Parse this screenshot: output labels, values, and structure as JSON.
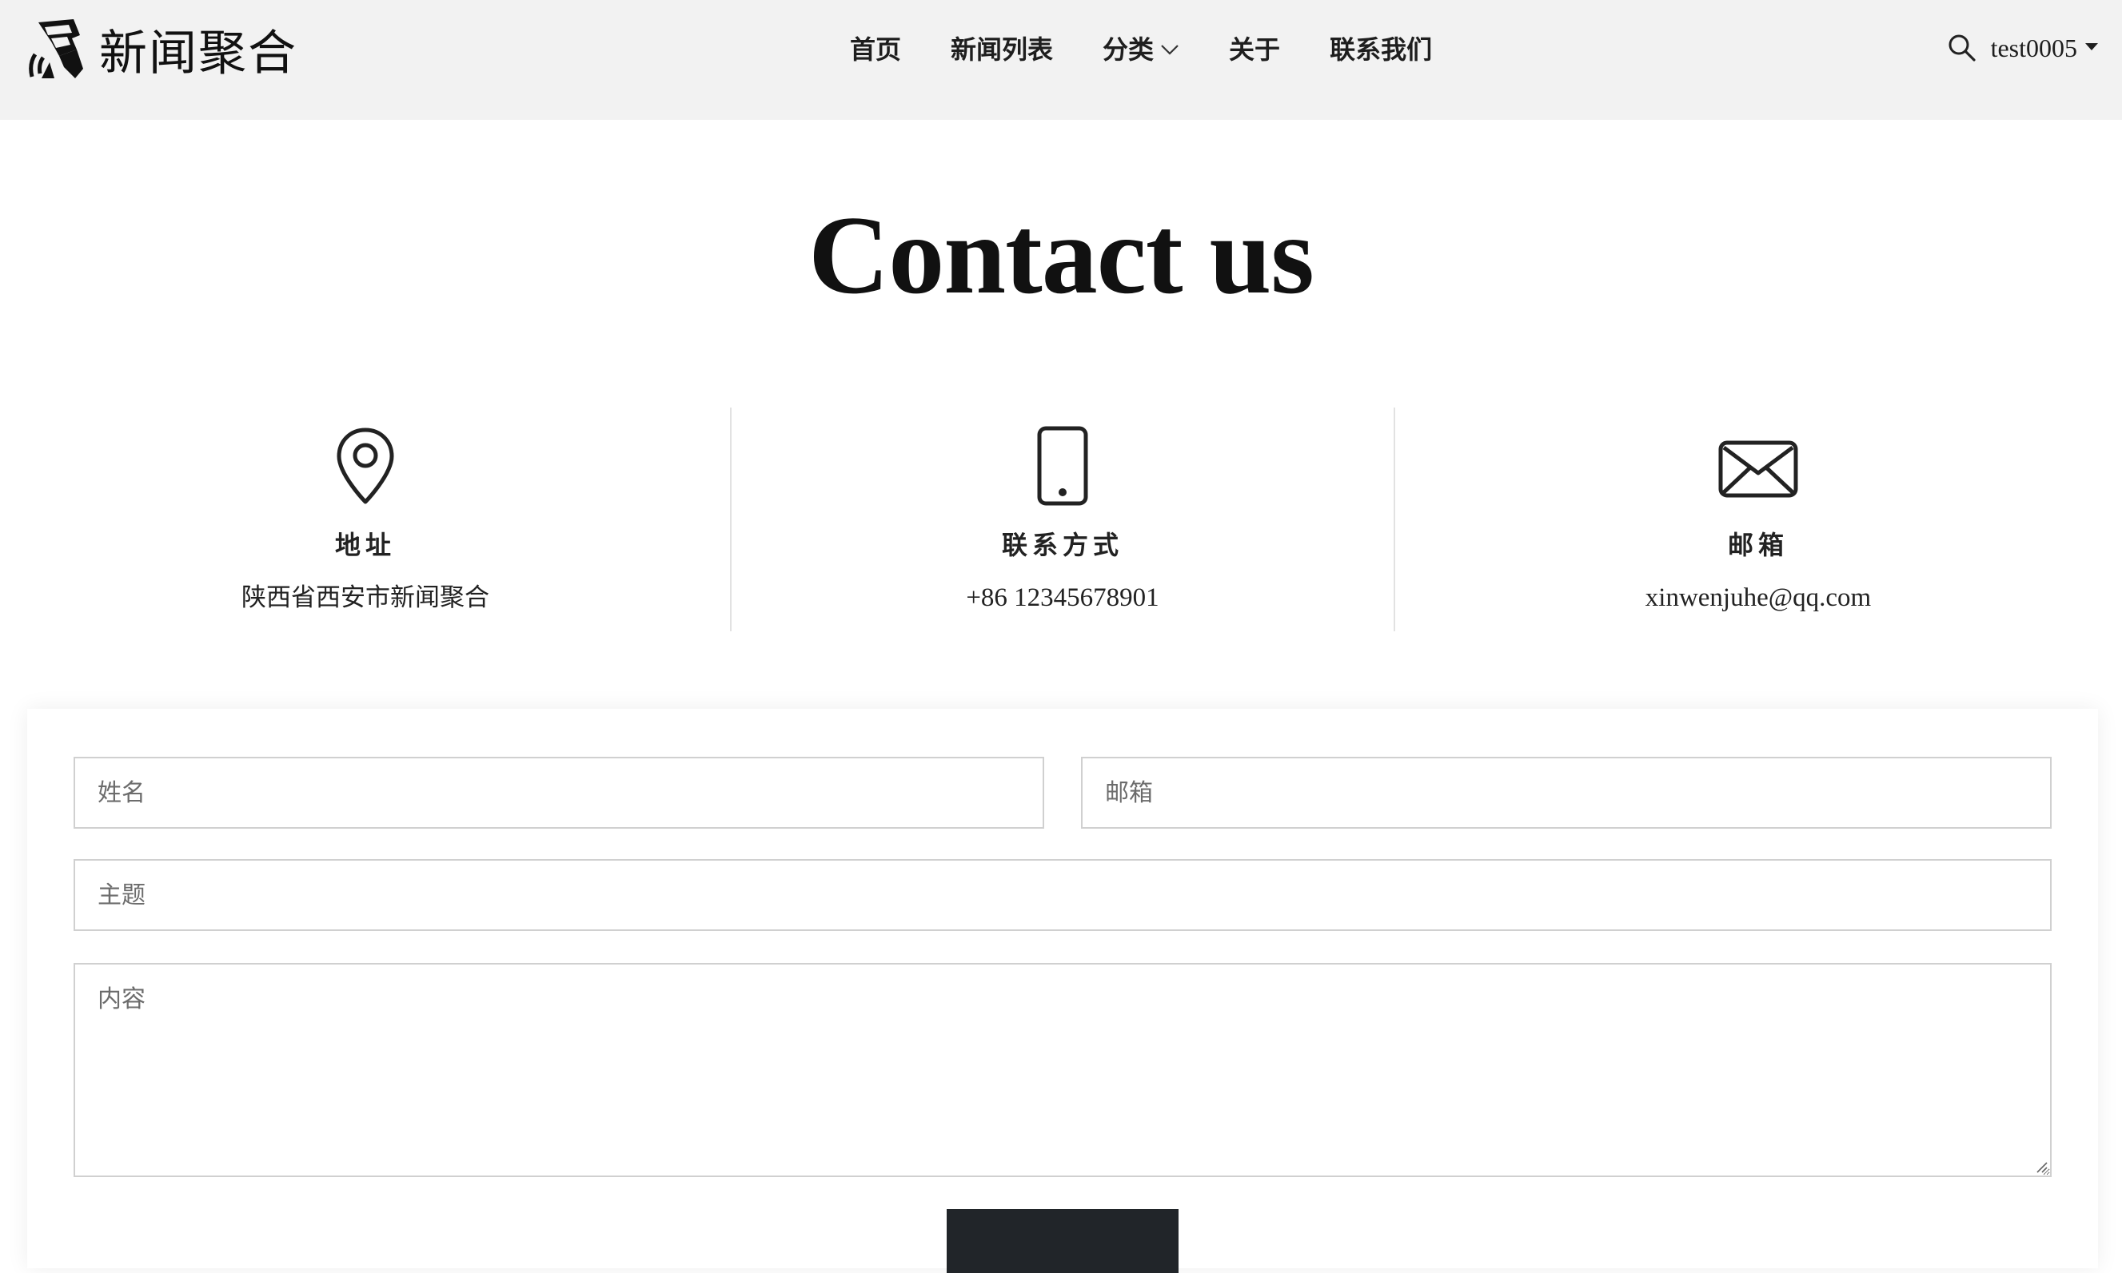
{
  "brand": {
    "name": "新闻聚合",
    "logo_icon": "newspaper-logo-icon"
  },
  "nav": {
    "items": [
      {
        "label": "首页"
      },
      {
        "label": "新闻列表"
      },
      {
        "label": "分类",
        "has_dropdown": true
      },
      {
        "label": "关于"
      },
      {
        "label": "联系我们"
      }
    ]
  },
  "header_right": {
    "search_icon": "search-icon",
    "username": "test0005"
  },
  "page": {
    "title": "Contact us"
  },
  "info": [
    {
      "icon": "map-pin-icon",
      "label": "地址",
      "value": "陕西省西安市新闻聚合"
    },
    {
      "icon": "smartphone-icon",
      "label": "联系方式",
      "value": "+86 12345678901"
    },
    {
      "icon": "envelope-icon",
      "label": "邮箱",
      "value": "xinwenjuhe@qq.com"
    }
  ],
  "form": {
    "name_placeholder": "姓名",
    "email_placeholder": "邮箱",
    "subject_placeholder": "主题",
    "content_placeholder": "内容",
    "submit_label": ""
  },
  "colors": {
    "header_bg": "#f2f2f2",
    "text": "#1e1e1e",
    "border": "#d0d0d0",
    "button_bg": "#212529"
  }
}
